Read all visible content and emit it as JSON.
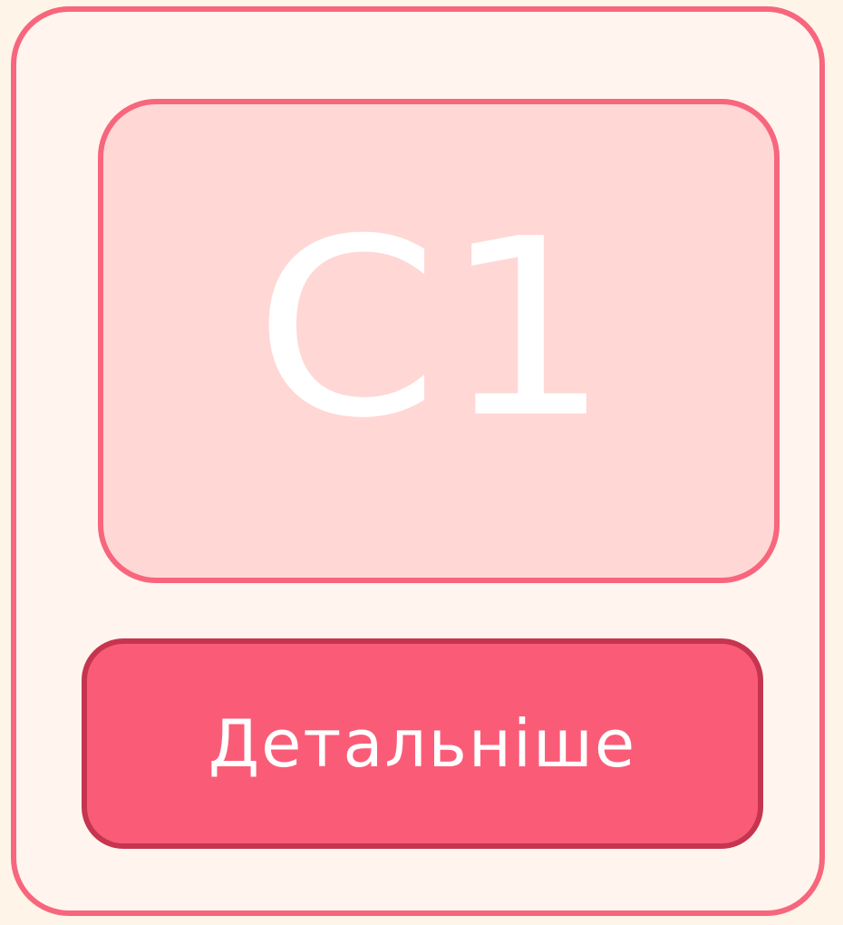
{
  "card": {
    "level": "C1",
    "button_label": "Детальніше"
  },
  "colors": {
    "page_background": "#FFF4E8",
    "card_background": "#FFF5EE",
    "card_border": "#F7667D",
    "panel_background": "#FFD7D5",
    "button_background": "#FA5C77",
    "button_border": "#C6354F",
    "text": "#FFFFFF"
  }
}
